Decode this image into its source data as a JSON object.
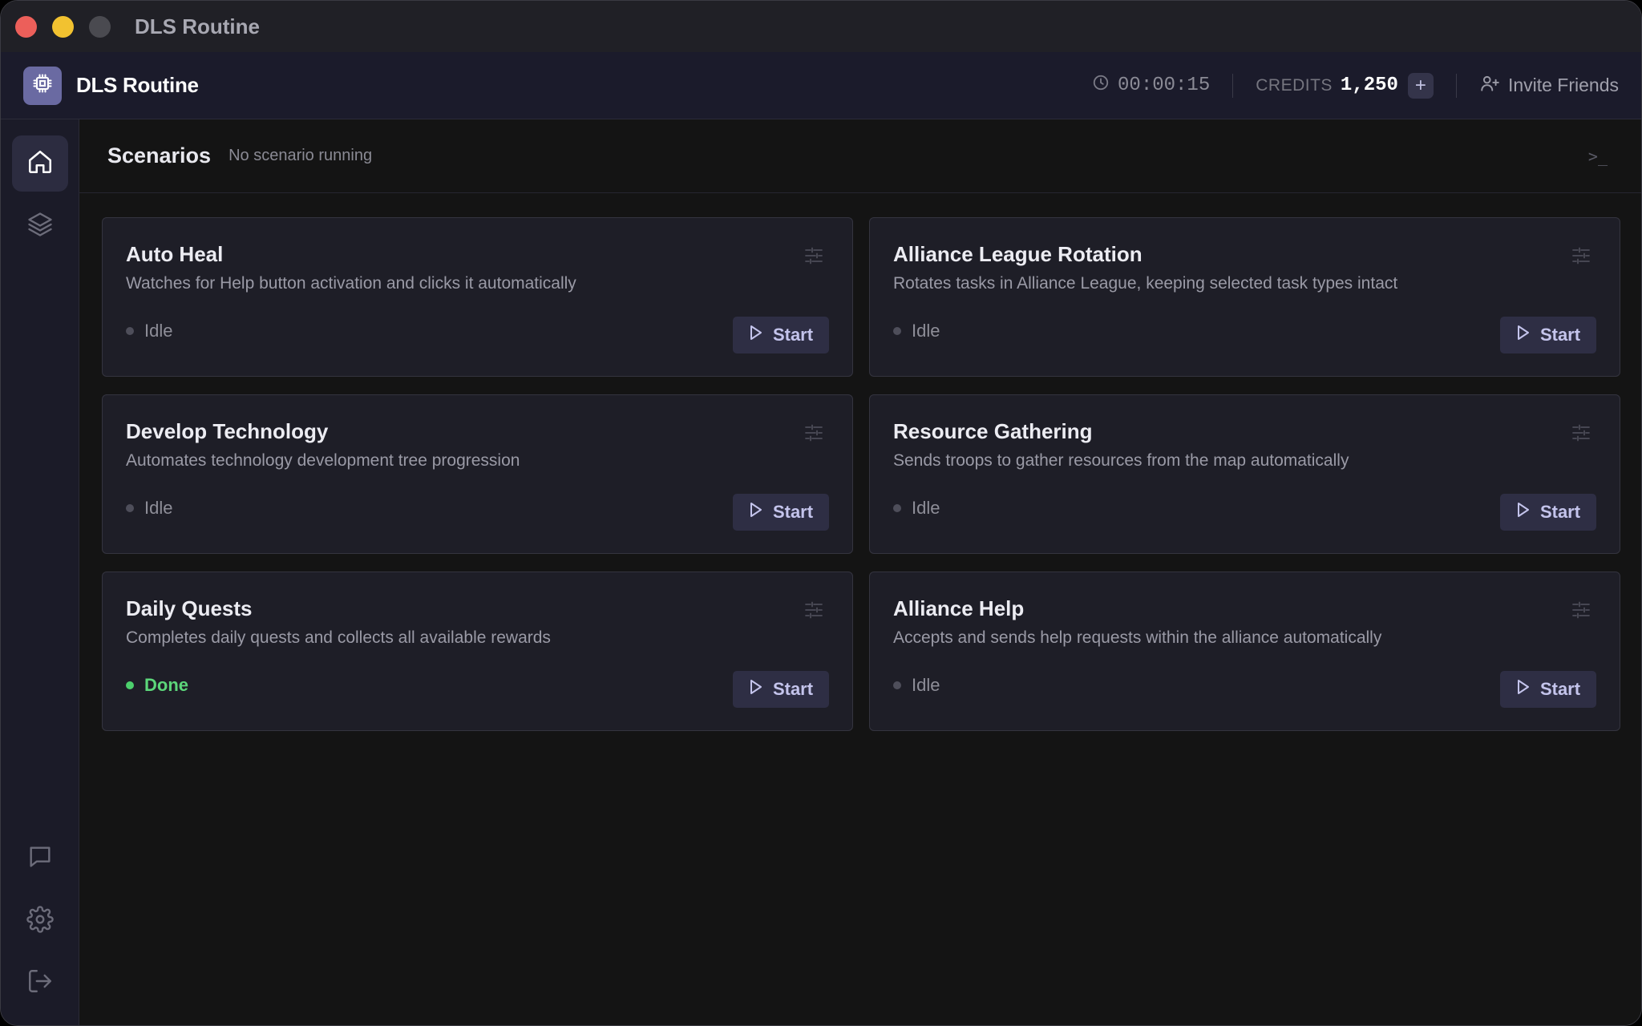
{
  "window": {
    "title": "DLS Routine"
  },
  "header": {
    "app_name": "DLS Routine",
    "timer": "00:00:15",
    "credits_label": "CREDITS",
    "credits_value": "1,250",
    "invite_label": "Invite Friends"
  },
  "sidebar": {
    "top": [
      {
        "icon": "home-icon",
        "active": true
      },
      {
        "icon": "layers-icon",
        "active": false
      }
    ],
    "bottom": [
      {
        "icon": "chat-icon"
      },
      {
        "icon": "gear-icon"
      },
      {
        "icon": "logout-icon"
      }
    ]
  },
  "main": {
    "title": "Scenarios",
    "status": "No scenario running",
    "terminal_glyph": ">_"
  },
  "cards": [
    {
      "title": "Auto Heal",
      "desc": "Watches for Help button activation and clicks it automatically",
      "status": "Idle",
      "button": "Start"
    },
    {
      "title": "Alliance League Rotation",
      "desc": "Rotates tasks in Alliance League, keeping selected task types intact",
      "status": "Idle",
      "button": "Start"
    },
    {
      "title": "Develop Technology",
      "desc": "Automates technology development tree progression",
      "status": "Idle",
      "button": "Start"
    },
    {
      "title": "Resource Gathering",
      "desc": "Sends troops to gather resources from the map automatically",
      "status": "Idle",
      "button": "Start"
    },
    {
      "title": "Daily Quests",
      "desc": "Completes daily quests and collects all available rewards",
      "status": "Done",
      "button": "Start"
    },
    {
      "title": "Alliance Help",
      "desc": "Accepts and sends help requests within the alliance automatically",
      "status": "Idle",
      "button": "Start"
    }
  ],
  "colors": {
    "accent": "#6a6aa2",
    "done": "#4ccf6c",
    "idle": "#4e4e5a",
    "button_bg": "#2e2e44"
  }
}
